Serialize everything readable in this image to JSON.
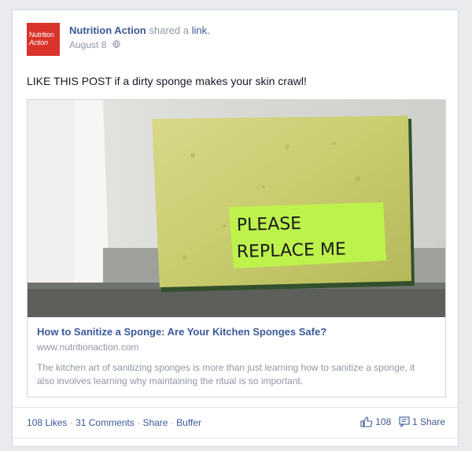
{
  "post": {
    "page_name": "Nutrition Action",
    "verb": "shared a",
    "object": "link.",
    "date": "August 8",
    "avatar_line1": "Nutrition",
    "avatar_line2": "Action",
    "text": "LIKE THIS POST if a dirty sponge makes your skin crawl!"
  },
  "photo": {
    "note_line1": "PLEASE",
    "note_line2": "REPLACE ME"
  },
  "link": {
    "title": "How to Sanitize a Sponge: Are Your Kitchen Sponges Safe?",
    "domain": "www.nutritionaction.com",
    "description": "The kitchen art of sanitizing sponges is more than just learning how to sanitize a sponge, it also involves learning why maintaining the ritual is so important."
  },
  "actions": {
    "likes": "108 Likes",
    "comments": "31 Comments",
    "share": "Share",
    "buffer": "Buffer",
    "separator": "·",
    "like_count": "108",
    "share_count": "1 Share"
  },
  "colors": {
    "brand": "#3b5998",
    "avatar": "#d9332b",
    "muted": "#9197a3"
  },
  "icons": [
    "globe-icon",
    "thumbs-up-icon",
    "share-icon"
  ]
}
